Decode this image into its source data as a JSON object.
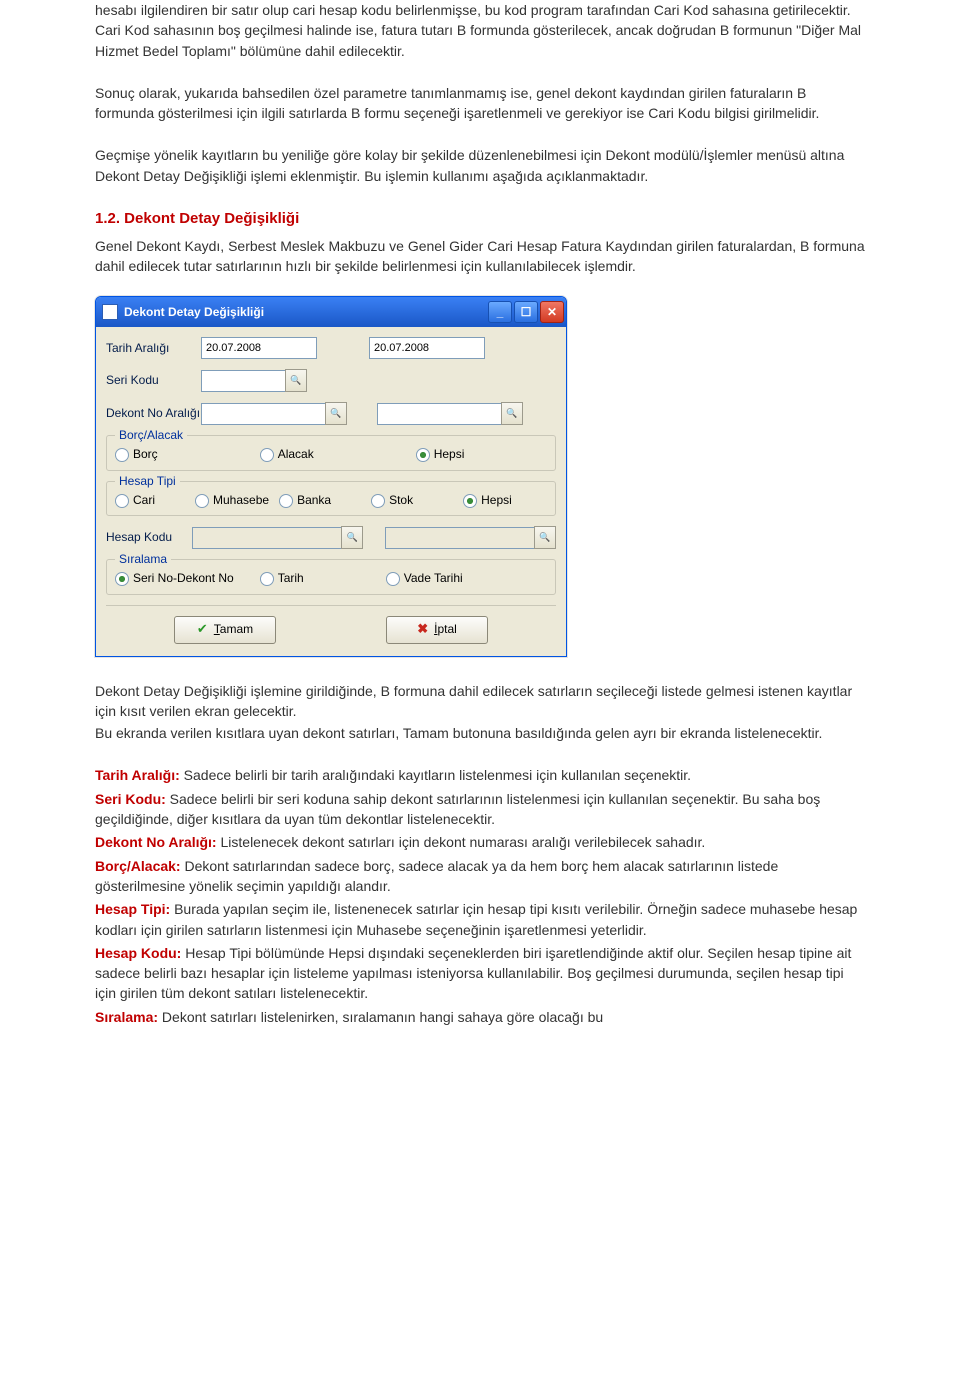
{
  "paragraphs": {
    "p1": "hesabı ilgilendiren bir satır olup cari hesap kodu belirlenmişse, bu kod program tarafından Cari Kod sahasına getirilecektir. Cari Kod sahasının boş geçilmesi halinde ise, fatura tutarı B formunda gösterilecek, ancak doğrudan B formunun \"Diğer Mal Hizmet Bedel Toplamı\" bölümüne dahil edilecektir.",
    "p2": "Sonuç olarak, yukarıda bahsedilen özel parametre tanımlanmamış ise, genel dekont kaydından girilen faturaların B formunda gösterilmesi için ilgili satırlarda B formu seçeneği işaretlenmeli ve gerekiyor ise Cari Kodu bilgisi girilmelidir.",
    "p3": "Geçmişe yönelik kayıtların bu yeniliğe göre kolay bir şekilde düzenlenebilmesi için Dekont modülü/İşlemler menüsü altına Dekont Detay Değişikliği işlemi eklenmiştir. Bu işlemin kullanımı aşağıda açıklanmaktadır."
  },
  "heading": "1.2.   Dekont Detay Değişikliği",
  "intro": "Genel Dekont Kaydı, Serbest Meslek Makbuzu ve Genel Gider Cari Hesap Fatura Kaydından girilen faturalardan, B formuna dahil edilecek tutar satırlarının hızlı bir şekilde belirlenmesi için kullanılabilecek işlemdir.",
  "dialog": {
    "title": "Dekont Detay Değişikliği",
    "labels": {
      "tarih": "Tarih Aralığı",
      "seri": "Seri Kodu",
      "dekont": "Dekont No Aralığı",
      "borc_legend": "Borç/Alacak",
      "hesaptipi_legend": "Hesap Tipi",
      "hesapkodu": "Hesap Kodu",
      "siralama_legend": "Sıralama"
    },
    "fields": {
      "date_from": "20.07.2008",
      "date_to": "20.07.2008"
    },
    "radios": {
      "borc": "Borç",
      "alacak": "Alacak",
      "hepsi": "Hepsi",
      "cari": "Cari",
      "muhasebe": "Muhasebe",
      "banka": "Banka",
      "stok": "Stok",
      "seri_dekont": "Seri No-Dekont No",
      "tarih": "Tarih",
      "vade": "Vade Tarihi"
    },
    "buttons": {
      "ok": "Tamam",
      "cancel": "İptal"
    }
  },
  "after1": "Dekont Detay Değişikliği işlemine girildiğinde, B formuna dahil edilecek satırların seçileceği listede gelmesi istenen kayıtlar için kısıt verilen ekran gelecektir.",
  "after2": "Bu ekranda verilen kısıtlara uyan dekont satırları, Tamam butonuna basıldığında gelen ayrı bir ekranda listelenecektir.",
  "defs": {
    "tarih_label": "Tarih Aralığı:",
    "tarih_text": " Sadece belirli bir tarih aralığındaki kayıtların listelenmesi için kullanılan seçenektir.",
    "seri_label": "Seri Kodu:",
    "seri_text": " Sadece belirli bir seri koduna sahip dekont satırlarının listelenmesi için kullanılan seçenektir. Bu saha boş geçildiğinde, diğer kısıtlara da uyan tüm dekontlar listelenecektir.",
    "dekont_label": "Dekont No Aralığı:",
    "dekont_text": " Listelenecek dekont satırları için dekont numarası aralığı verilebilecek sahadır.",
    "borc_label": "Borç/Alacak:",
    "borc_text": " Dekont satırlarından sadece borç, sadece alacak ya da hem borç hem alacak satırlarının listede gösterilmesine yönelik seçimin yapıldığı alandır.",
    "hesaptipi_label": "Hesap Tipi:",
    "hesaptipi_text": " Burada yapılan seçim ile, listenenecek satırlar için hesap tipi kısıtı verilebilir. Örneğin sadece muhasebe hesap kodları için girilen satırların listenmesi için Muhasebe seçeneğinin işaretlenmesi yeterlidir.",
    "hesapkodu_label": "Hesap Kodu:",
    "hesapkodu_text": " Hesap Tipi bölümünde Hepsi dışındaki seçeneklerden biri işaretlendiğinde aktif olur. Seçilen hesap tipine ait sadece belirli bazı hesaplar için listeleme yapılması isteniyorsa kullanılabilir.  Boş geçilmesi durumunda, seçilen hesap tipi için girilen tüm dekont satıları listelenecektir.",
    "siralama_label": "Sıralama:",
    "siralama_text": " Dekont satırları listelenirken, sıralamanın hangi sahaya göre olacağı bu"
  }
}
